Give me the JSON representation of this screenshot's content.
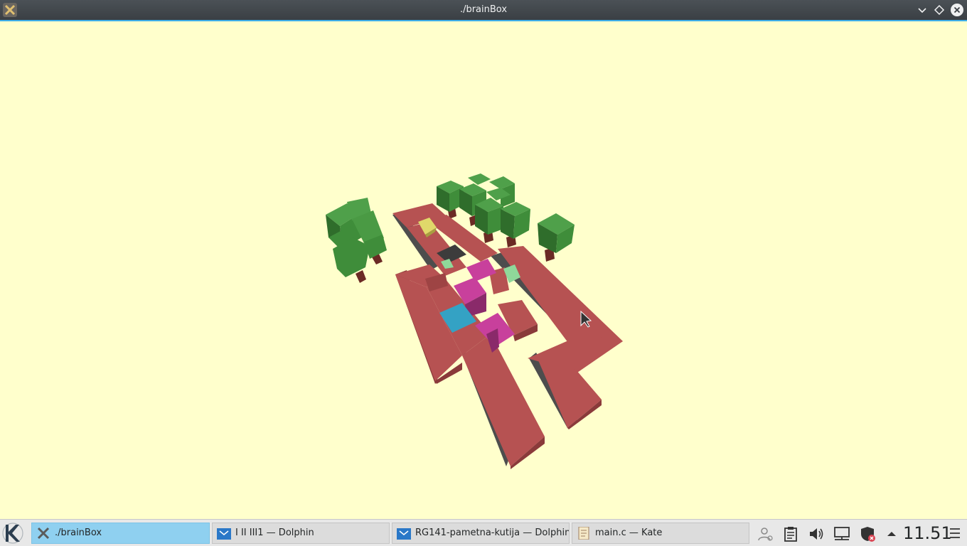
{
  "window": {
    "title": "./brainBox",
    "buttons": [
      "minimize",
      "maximize",
      "close"
    ]
  },
  "game": {
    "background_color": "#ffffcc",
    "colors": {
      "floor": "#b65252",
      "wall": "#4d4d4d",
      "pink_block": "#c8409c",
      "blue_block": "#34a2c4",
      "yellow_block": "#e0d86a",
      "green_block": "#8fd89a",
      "tree_leaves": "#3f8d3a",
      "tree_trunk": "#6b2a24"
    }
  },
  "taskbar": {
    "tasks": [
      {
        "label": "./brainBox",
        "icon": "x-app-icon",
        "active": true
      },
      {
        "label": "I II III1 — Dolphin",
        "icon": "folder-icon",
        "active": false
      },
      {
        "label": "RG141-pametna-kutija — Dolphin",
        "icon": "folder-icon",
        "active": false
      },
      {
        "label": "main.c  — Kate",
        "icon": "text-editor-icon",
        "active": false
      }
    ],
    "tray_icons": [
      "user-icon",
      "clipboard-icon",
      "volume-icon",
      "network-icon",
      "security-icon",
      "expand-arrow-icon"
    ],
    "clock": "11.51"
  }
}
